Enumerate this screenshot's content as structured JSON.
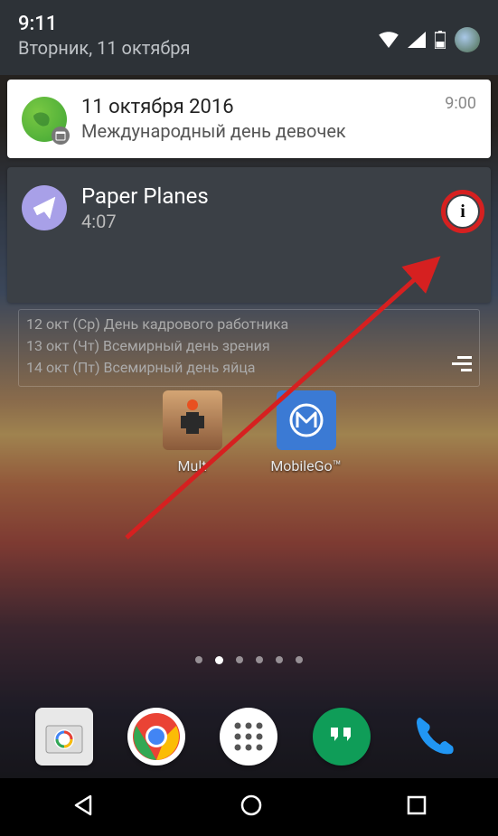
{
  "status": {
    "time": "9:11",
    "date": "Вторник, 11 октября"
  },
  "notifications": [
    {
      "title": "11 октября 2016",
      "subtitle": "Международный день девочек",
      "time": "9:00"
    },
    {
      "title": "Paper Planes",
      "subtitle": "4:07"
    }
  ],
  "calendar_widget": {
    "lines": [
      "12 окт (Ср) День кадрового работника",
      "13 окт (Чт) Всемирный день зрения",
      "14 окт (Пт) Всемирный день яйца"
    ]
  },
  "home_apps": [
    {
      "label": "Mult"
    },
    {
      "label": "MobileGo™"
    }
  ],
  "info_glyph": "i"
}
